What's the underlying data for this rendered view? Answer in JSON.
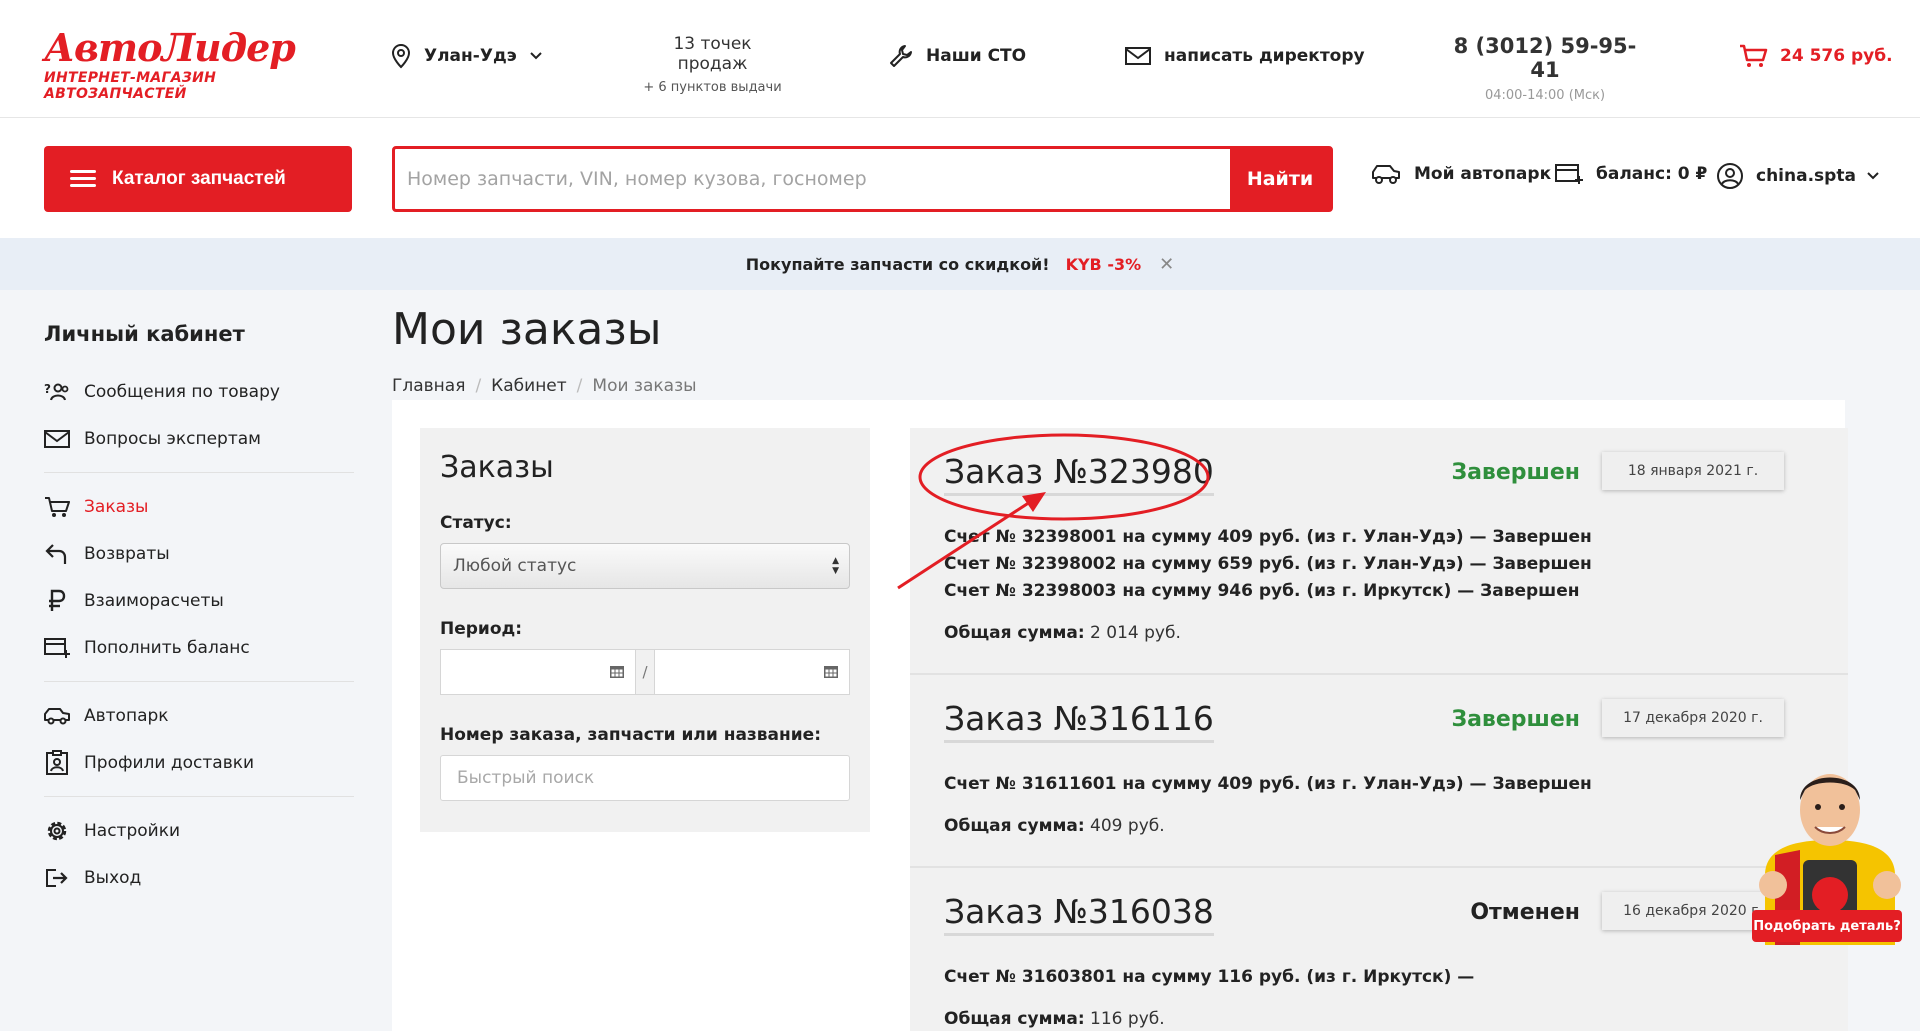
{
  "header": {
    "logo_main": "АвтоЛидер",
    "logo_sub": "ИНТЕРНЕТ-МАГАЗИН АВТОЗАПЧАСТЕЙ",
    "city": "Улан-Удэ",
    "points_line1": "13 точек продаж",
    "points_line2": "+ 6 пунктов выдачи",
    "sto": "Наши СТО",
    "director": "написать директору",
    "phone": "8 (3012) 59-95-41",
    "hours": "04:00-14:00 (Мск)",
    "cart_total": "24 576 руб."
  },
  "search": {
    "catalog_label": "Каталог запчастей",
    "placeholder": "Номер запчасти, VIN, номер кузова, госномер",
    "button": "Найти"
  },
  "account": {
    "garage": "Мой автопарк",
    "balance": "баланс: 0 ₽",
    "username": "china.spta"
  },
  "promo": {
    "text": "Покупайте запчасти со скидкой!",
    "discount": "KYB -3%",
    "close": "✕"
  },
  "sidebar": {
    "title": "Личный кабинет",
    "items": [
      {
        "label": "Сообщения по товару"
      },
      {
        "label": "Вопросы экспертам"
      },
      {
        "label": "Заказы"
      },
      {
        "label": "Возвраты"
      },
      {
        "label": "Взаиморасчеты"
      },
      {
        "label": "Пополнить баланс"
      },
      {
        "label": "Автопарк"
      },
      {
        "label": "Профили доставки"
      },
      {
        "label": "Настройки"
      },
      {
        "label": "Выход"
      }
    ]
  },
  "main": {
    "title": "Мои заказы",
    "breadcrumb": [
      "Главная",
      "Кабинет",
      "Мои заказы"
    ]
  },
  "filter": {
    "title": "Заказы",
    "status_label": "Статус:",
    "status_value": "Любой статус",
    "period_label": "Период:",
    "period_sep": "/",
    "search_label": "Номер заказа, запчасти или название:",
    "search_placeholder": "Быстрый поиск"
  },
  "orders": [
    {
      "title": "Заказ №323980",
      "status": "Завершен",
      "date": "18 января 2021 г.",
      "invoices": [
        "Счет № 32398001 на сумму 409 руб. (из г. Улан-Удэ) — Завершен",
        "Счет № 32398002 на сумму 659 руб. (из г. Улан-Удэ) — Завершен",
        "Счет № 32398003 на сумму 946 руб. (из г. Иркутск) — Завершен"
      ],
      "total_label": "Общая сумма:",
      "total_value": "2 014 руб."
    },
    {
      "title": "Заказ №316116",
      "status": "Завершен",
      "date": "17 декабря 2020 г.",
      "invoices": [
        "Счет № 31611601 на сумму 409 руб. (из г. Улан-Удэ) — Завершен"
      ],
      "total_label": "Общая сумма:",
      "total_value": "409 руб."
    },
    {
      "title": "Заказ №316038",
      "status": "Отменен",
      "date": "16 декабря 2020 г.",
      "invoices": [
        "Счет № 31603801 на сумму 116 руб. (из г. Иркутск) —"
      ],
      "total_label": "Общая сумма:",
      "total_value": "116 руб."
    }
  ],
  "mascot": {
    "button": "Подобрать деталь?"
  },
  "colors": {
    "brand": "#e31e24",
    "status_done": "#2f8f3c"
  }
}
